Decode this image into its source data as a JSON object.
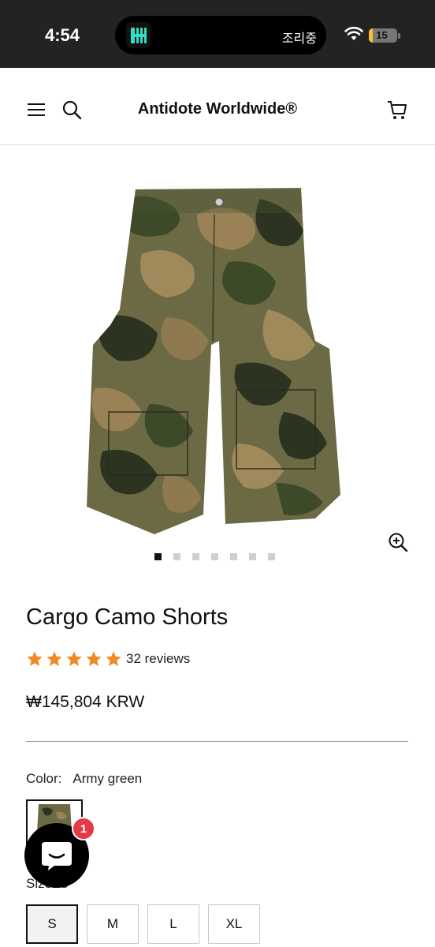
{
  "status_bar": {
    "time": "4:54",
    "island_text": "조리중",
    "battery": "15",
    "battery_level_percent": 15,
    "icons": [
      "wifi-icon",
      "battery-icon"
    ]
  },
  "header": {
    "brand": "Antidote Worldwide®",
    "icons": [
      "menu-icon",
      "search-icon",
      "cart-icon"
    ]
  },
  "gallery": {
    "image_alt": "camouflage cargo shorts",
    "dot_count": 7,
    "active_index": 0,
    "zoom_icon": "zoom-in-icon"
  },
  "product": {
    "title": "Cargo Camo Shorts",
    "rating_stars": 5,
    "review_count": "32 reviews",
    "price": "₩145,804 KRW"
  },
  "color": {
    "label": "Color:",
    "value": "Army green"
  },
  "size": {
    "label": "Size:",
    "value": "S",
    "options": [
      "S",
      "M",
      "L",
      "XL"
    ],
    "selected": "S"
  },
  "chat": {
    "badge": "1",
    "icon": "chat-icon"
  },
  "colors": {
    "star": "#f08a24",
    "accent": "#111111",
    "badge": "#e63946",
    "island_logo": "#2fe0c8"
  }
}
